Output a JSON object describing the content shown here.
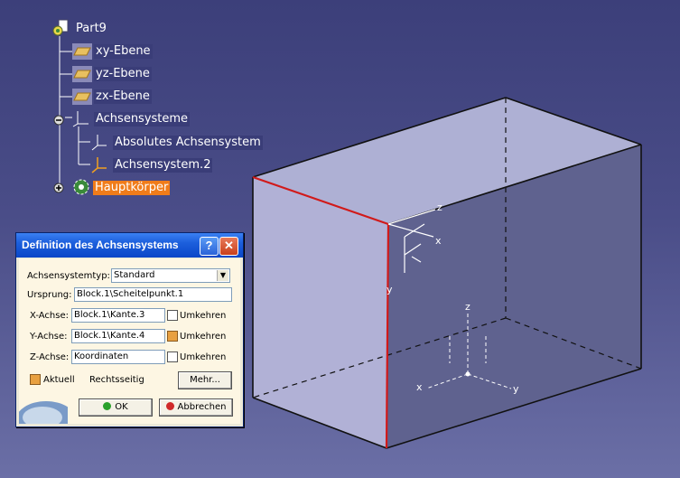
{
  "tree": {
    "root": "Part9",
    "planes": [
      "xy-Ebene",
      "yz-Ebene",
      "zx-Ebene"
    ],
    "axis_systems": "Achsensysteme",
    "absolute_axis": "Absolutes Achsensystem",
    "axis_system_2": "Achsensystem.2",
    "main_body": "Hauptkörper"
  },
  "dialog": {
    "title": "Definition des Achsensystems",
    "help": "?",
    "close": "✕",
    "type_label": "Achsensystemtyp:",
    "type_value": "Standard",
    "origin_label": "Ursprung:",
    "origin_value": "Block.1\\Scheitelpunkt.1",
    "x_label": "X-Achse:",
    "x_value": "Block.1\\Kante.3",
    "x_reverse": "Umkehren",
    "y_label": "Y-Achse:",
    "y_value": "Block.1\\Kante.4",
    "y_reverse": "Umkehren",
    "z_label": "Z-Achse:",
    "z_value": "Koordinaten",
    "z_reverse": "Umkehren",
    "current": "Aktuell",
    "handedness": "Rechtsseitig",
    "more": "Mehr...",
    "ok": "OK",
    "cancel": "Abbrechen"
  },
  "viewport": {
    "axis_local": {
      "z": "z",
      "x": "x",
      "y": "y"
    },
    "axis_compass": {
      "z": "z",
      "x": "x",
      "y": "y"
    }
  },
  "colors": {
    "background_top": "#3c3f7a",
    "box_face": "#a9a9cf",
    "highlight_edge": "#d11a1a",
    "selection": "#f07c1a"
  }
}
